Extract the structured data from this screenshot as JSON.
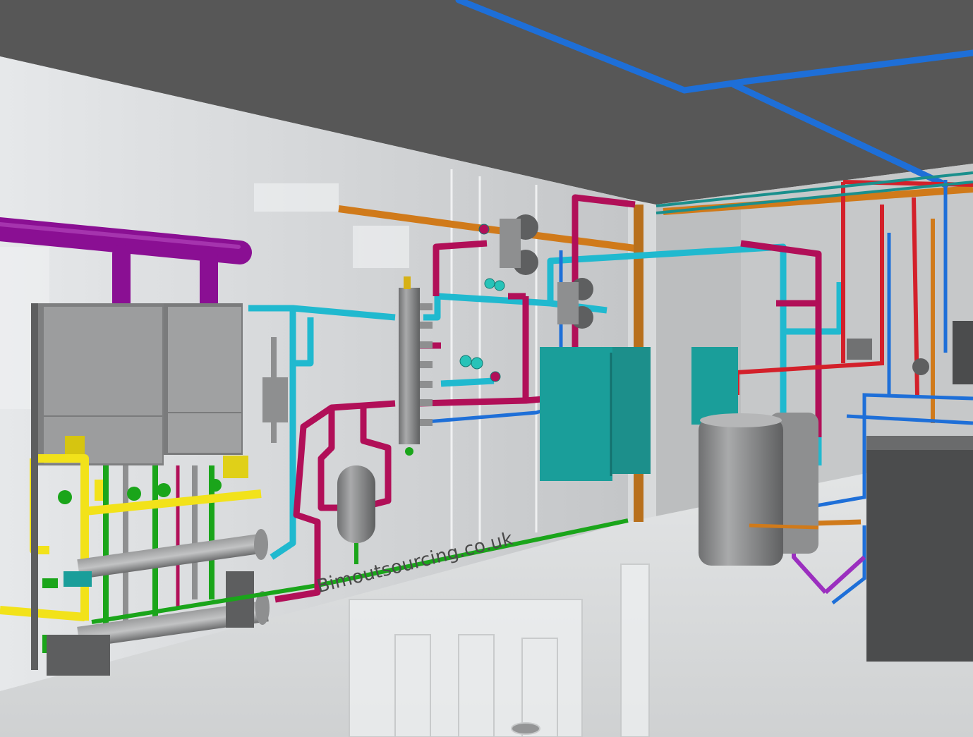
{
  "watermark": "Bimoutsourcing.co.uk",
  "colors": {
    "ceiling": "#545454",
    "wall": "#c9cbcc",
    "floor": "#d9dbdc",
    "gas_purple": "#8a0f93",
    "cold_cyan": "#20b9cf",
    "flow_magenta": "#b10f58",
    "hot_red": "#d3202a",
    "cold_blue": "#1e6fd8",
    "condensate_orange": "#d07a1a",
    "drain_green": "#1aa51a",
    "gas_yellow": "#f2e21a",
    "panel_teal": "#1a9e9a",
    "equipment_grey": "#8e8f90"
  },
  "icons": [
    "boiler-unit",
    "pump",
    "pressure-gauge",
    "expansion-vessel",
    "header-manifold",
    "control-panel",
    "hot-water-cylinder",
    "floor-drain"
  ]
}
